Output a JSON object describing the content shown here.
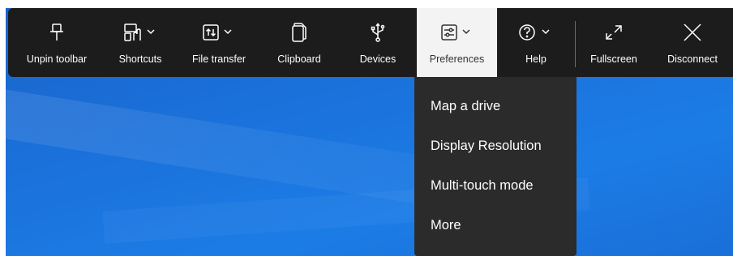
{
  "toolbar": {
    "items": [
      {
        "label": "Unpin toolbar",
        "icon": "pin-icon"
      },
      {
        "label": "Shortcuts",
        "icon": "shortcuts-icon"
      },
      {
        "label": "File transfer",
        "icon": "file-transfer-icon"
      },
      {
        "label": "Clipboard",
        "icon": "clipboard-icon"
      },
      {
        "label": "Devices",
        "icon": "usb-icon"
      },
      {
        "label": "Preferences",
        "icon": "preferences-icon"
      },
      {
        "label": "Help",
        "icon": "help-icon"
      },
      {
        "label": "Fullscreen",
        "icon": "fullscreen-icon"
      },
      {
        "label": "Disconnect",
        "icon": "close-icon"
      }
    ]
  },
  "preferences_menu": {
    "items": [
      {
        "label": "Map a drive"
      },
      {
        "label": "Display Resolution"
      },
      {
        "label": "Multi-touch mode"
      },
      {
        "label": "More"
      }
    ]
  },
  "colors": {
    "toolbar_bg": "#1c1c1c",
    "menu_bg": "#2b2b2b",
    "active_tab_bg": "#f3f3f3",
    "desktop_blue": "#1b72dc"
  }
}
